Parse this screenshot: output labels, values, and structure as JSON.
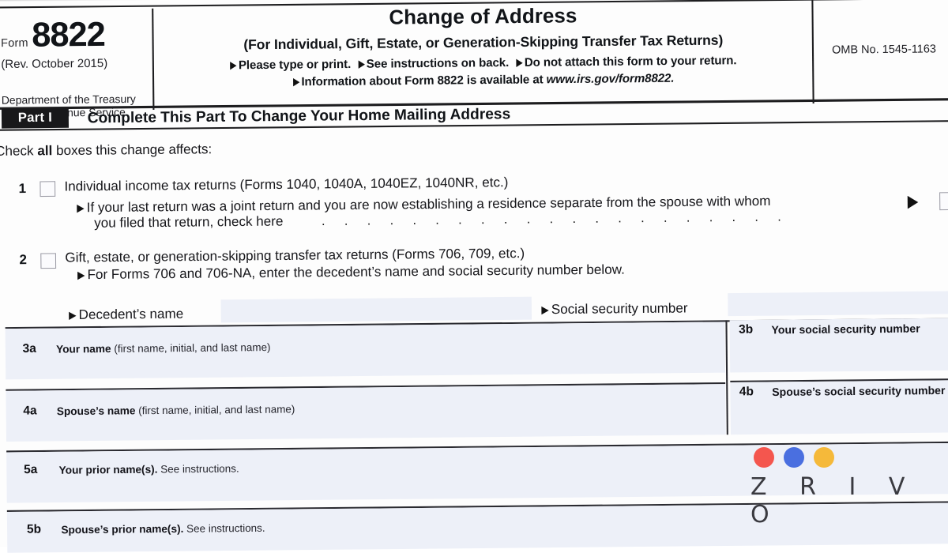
{
  "form": {
    "form_word": "Form",
    "form_number": "8822",
    "revision": "(Rev. October 2015)",
    "department_line1": "Department of the Treasury",
    "department_line2": "Internal Revenue Service",
    "title": "Change of Address",
    "subtitle": "(For Individual, Gift, Estate, or Generation-Skipping Transfer Tax Returns)",
    "instruction_line1_a": "Please type or print.",
    "instruction_line1_b": "See instructions on back.",
    "instruction_line1_c": "Do not attach this form to your return.",
    "instruction_line2_text": "Information about Form 8822 is available at",
    "instruction_line2_url": "www.irs.gov/form8822.",
    "omb": "OMB No. 1545-1163"
  },
  "part": {
    "tag": "Part I",
    "title": "Complete This Part To Change Your Home Mailing Address",
    "check_prompt_pre": "Check ",
    "check_prompt_bold": "all",
    "check_prompt_post": " boxes this change affects:"
  },
  "lines": {
    "line1": {
      "number": "1",
      "text": "Individual income tax returns (Forms 1040, 1040A, 1040EZ, 1040NR, etc.)",
      "sub_line1": "If your last return was a joint return and you are now establishing a residence separate from the spouse with whom",
      "sub_line2": "you filed that return, check here",
      "leader_dots": ". . . . . . . . . . . . . . . . . . . . ."
    },
    "line2": {
      "number": "2",
      "text": "Gift, estate, or generation-skipping transfer tax returns (Forms 706, 709, etc.)",
      "sub_line1": "For Forms 706 and 706-NA, enter the decedent’s name and social security number below."
    }
  },
  "fields": {
    "decedent_name_label": "Decedent’s name",
    "social_security_number_label": "Social security number",
    "rows": [
      {
        "number": "3a",
        "label_bold": "Your name",
        "label_rest": " (first name, initial, and last name)",
        "right_number": "3b",
        "right_label": "Your social security number"
      },
      {
        "number": "4a",
        "label_bold": "Spouse’s name",
        "label_rest": " (first name, initial, and last name)",
        "right_number": "4b",
        "right_label": "Spouse’s social security number"
      },
      {
        "number": "5a",
        "label_bold": "Your prior name(s).",
        "label_rest": " See instructions.",
        "right_number": "",
        "right_label": ""
      },
      {
        "number": "5b",
        "label_bold": "Spouse’s prior name(s).",
        "label_rest": " See instructions.",
        "right_number": "",
        "right_label": ""
      }
    ]
  },
  "watermark": {
    "brand": "Z R I V O",
    "dot_colors": [
      "#f4564e",
      "#4a6fe0",
      "#f5b93a"
    ]
  },
  "colors": {
    "ink": "#16161a",
    "field_shade": "#edf0f8",
    "part_bar": "#18181a"
  }
}
